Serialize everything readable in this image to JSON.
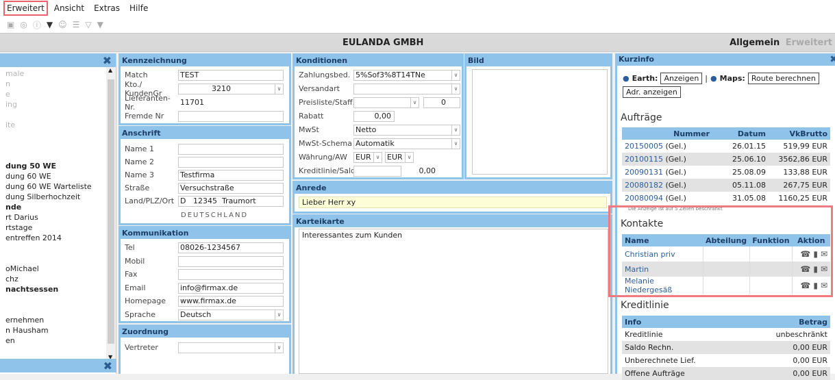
{
  "menu": [
    "Erweitert",
    "Ansicht",
    "Extras",
    "Hilfe"
  ],
  "app_title": "EULANDA GMBH",
  "view_tabs": {
    "active": "Allgemein",
    "inactive": "Erweitert"
  },
  "left_list": [
    {
      "t": "male",
      "s": "g"
    },
    {
      "t": "n",
      "s": "g"
    },
    {
      "t": "e",
      "s": "g"
    },
    {
      "t": "ing",
      "s": "g"
    },
    {
      "t": "",
      "s": ""
    },
    {
      "t": "ite",
      "s": "g"
    },
    {
      "t": "",
      "s": ""
    },
    {
      "t": "",
      "s": ""
    },
    {
      "t": "",
      "s": ""
    },
    {
      "t": "dung 50 WE",
      "s": "b"
    },
    {
      "t": "dung 60 WE",
      "s": ""
    },
    {
      "t": "dung 60 WE Warteliste",
      "s": ""
    },
    {
      "t": "dung Silberhochzeit",
      "s": ""
    },
    {
      "t": "nde",
      "s": "b"
    },
    {
      "t": "rt Darius",
      "s": ""
    },
    {
      "t": "rtstage",
      "s": ""
    },
    {
      "t": "entreffen 2014",
      "s": ""
    },
    {
      "t": "",
      "s": ""
    },
    {
      "t": "",
      "s": ""
    },
    {
      "t": "oMichael",
      "s": ""
    },
    {
      "t": "chz",
      "s": ""
    },
    {
      "t": "nachtsessen",
      "s": "b"
    },
    {
      "t": "",
      "s": ""
    },
    {
      "t": "",
      "s": ""
    },
    {
      "t": "ernehmen",
      "s": ""
    },
    {
      "t": "n Hausham",
      "s": ""
    },
    {
      "t": "en",
      "s": ""
    }
  ],
  "kennzeichnung": {
    "title": "Kennzeichnung",
    "fields": [
      {
        "label": "Match",
        "value": "TEST"
      },
      {
        "label": "Kto./ KundenGr",
        "value": "3210"
      },
      {
        "label": "Lieferanten-Nr.",
        "value": "11701"
      },
      {
        "label": "Fremde Nr",
        "value": ""
      }
    ]
  },
  "anschrift": {
    "title": "Anschrift",
    "fields": [
      {
        "label": "Name 1",
        "value": ""
      },
      {
        "label": "Name 2",
        "value": ""
      },
      {
        "label": "Name 3",
        "value": "Testfirma"
      },
      {
        "label": "Straße",
        "value": "Versuchstraße"
      },
      {
        "label": "Land/PLZ/Ort",
        "value": "D   12345  Traumort"
      }
    ],
    "country": "DEUTSCHLAND"
  },
  "kommunikation": {
    "title": "Kommunikation",
    "fields": [
      {
        "label": "Tel",
        "value": "08026-1234567"
      },
      {
        "label": "Mobil",
        "value": ""
      },
      {
        "label": "Fax",
        "value": ""
      },
      {
        "label": "Email",
        "value": "info@firmax.de"
      },
      {
        "label": "Homepage",
        "value": "www.firmax.de"
      },
      {
        "label": "Sprache",
        "value": "Deutsch"
      }
    ]
  },
  "zuordnung": {
    "title": "Zuordnung",
    "label": "Vertreter",
    "value": ""
  },
  "konditionen": {
    "title": "Konditionen",
    "fields": [
      {
        "label": "Zahlungsbed.",
        "value": "5%Sof3%8T14TNe"
      },
      {
        "label": "Versandart",
        "value": ""
      },
      {
        "label": "Preisliste/Staff.",
        "value": "",
        "extra": "0"
      },
      {
        "label": "Rabatt",
        "value": "0,00"
      },
      {
        "label": "MwSt",
        "value": "Netto"
      },
      {
        "label": "MwSt-Schema",
        "value": "Automatik"
      },
      {
        "label": "Währung/AW",
        "value": "EUR",
        "extra": "EUR"
      },
      {
        "label": "Kreditlinie/Sald.",
        "value": "",
        "extra": "0,00"
      }
    ]
  },
  "bild": {
    "title": "Bild"
  },
  "anrede": {
    "title": "Anrede",
    "value": "Lieber Herr xy"
  },
  "karteikarte": {
    "title": "Karteikarte",
    "value": "Interessantes zum Kunden"
  },
  "kurzinfo": {
    "title": "Kurzinfo",
    "earth_label": "Earth:",
    "earth_btn": "Anzeigen",
    "maps_label": "Maps:",
    "maps_btn": "Route berechnen",
    "adr_btn": "Adr. anzeigen",
    "auftraege_title": "Aufträge",
    "auftraege_cols": [
      "Nummer",
      "Datum",
      "VkBrutto"
    ],
    "auftraege": [
      {
        "nr": "20150005",
        "st": " (Gel.)",
        "d": "26.01.15",
        "v": "519,99 EUR"
      },
      {
        "nr": "20100115",
        "st": " (Gel.)",
        "d": "25.06.10",
        "v": "3562,86 EUR"
      },
      {
        "nr": "20090131",
        "st": " (Gel.)",
        "d": "25.08.09",
        "v": "133,88 EUR"
      },
      {
        "nr": "20080182",
        "st": " (Gel.)",
        "d": "05.11.08",
        "v": "267,75 EUR"
      },
      {
        "nr": "20080094",
        "st": " (Gel.)",
        "d": "31.05.08",
        "v": "1160,25 EUR"
      }
    ],
    "auftraege_note": "Die Anzeige ist auf 5 Zeilen beschränkt",
    "kontakte_title": "Kontakte",
    "kontakte_cols": [
      "Name",
      "Abteilung",
      "Funktion",
      "Aktion"
    ],
    "kontakte": [
      "Christian priv",
      "Martin",
      "Melanie Niedergesäß"
    ],
    "kredit_title": "Kreditlinie",
    "kredit_cols": [
      "Info",
      "Betrag"
    ],
    "kredit": [
      {
        "i": "Kreditlinie",
        "b": "unbeschränkt"
      },
      {
        "i": "Saldo Rechn.",
        "b": "0,00 EUR"
      },
      {
        "i": "Unberechnete Lief.",
        "b": "0,00 EUR"
      },
      {
        "i": "Offene Aufträge",
        "b": "0,00 EUR"
      }
    ]
  },
  "colors": {
    "accent": "#8fc3ea",
    "highlight": "#ef7b80"
  }
}
